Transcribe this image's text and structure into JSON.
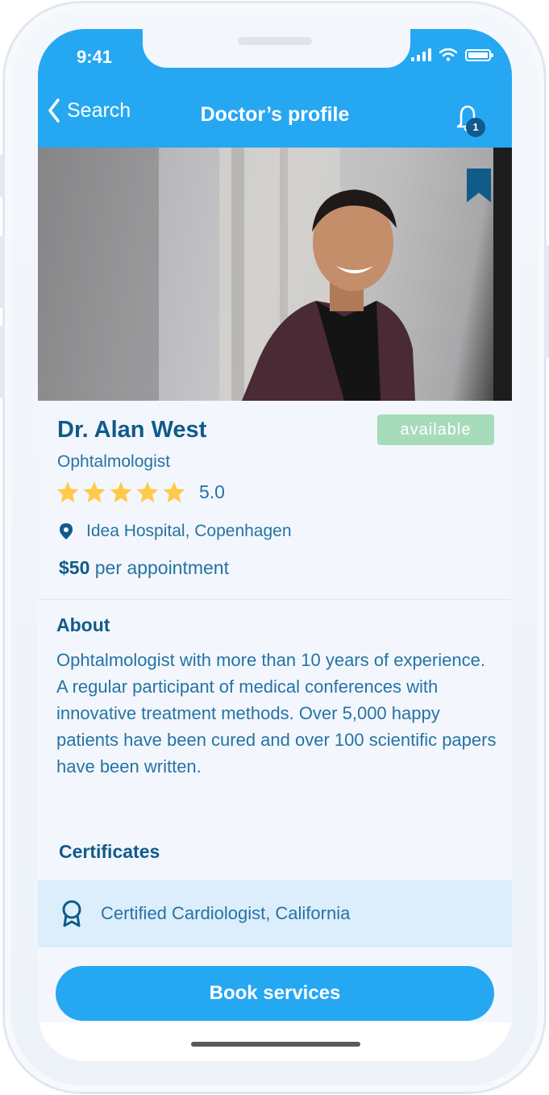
{
  "status_bar": {
    "time": "9:41"
  },
  "header": {
    "back_label": "Search",
    "title": "Doctor’s profile",
    "notification_count": "1"
  },
  "doctor": {
    "name": "Dr. Alan West",
    "availability": "available",
    "specialty": "Ophtalmologist",
    "rating": "5.0",
    "stars": 5,
    "location": "Idea Hospital, Copenhagen",
    "price_amount": "$50",
    "price_suffix": " per appointment"
  },
  "about": {
    "title": "About",
    "text": "Ophtalmologist with more than 10 years of experience. A regular participant of medical conferences with innovative treatment methods. Over 5,000 happy patients have been cured and over 100 scientific papers have been written."
  },
  "certificates": {
    "title": "Certificates",
    "items": [
      {
        "label": "Certified Cardiologist, California",
        "icon": "award-icon"
      }
    ]
  },
  "actions": {
    "book_label": "Book services"
  },
  "colors": {
    "primary": "#26a7f2",
    "dark_text": "#0f5b8a",
    "text": "#2573a4",
    "available": "#a7dcba",
    "star": "#ffc94a"
  }
}
